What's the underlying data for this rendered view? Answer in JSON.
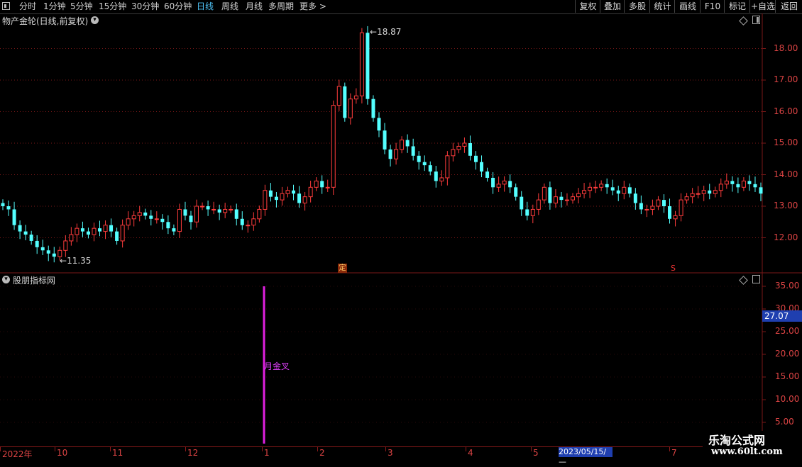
{
  "toolbar": {
    "periods": [
      {
        "label": "分时",
        "active": false
      },
      {
        "label": "1分钟",
        "active": false
      },
      {
        "label": "5分钟",
        "active": false
      },
      {
        "label": "15分钟",
        "active": false
      },
      {
        "label": "30分钟",
        "active": false
      },
      {
        "label": "60分钟",
        "active": false
      },
      {
        "label": "日线",
        "active": true
      },
      {
        "label": "周线",
        "active": false
      },
      {
        "label": "月线",
        "active": false
      },
      {
        "label": "多周期",
        "active": false
      },
      {
        "label": "更多 >",
        "active": false
      }
    ],
    "buttons": [
      "复权",
      "叠加",
      "多股",
      "统计",
      "画线",
      "F10",
      "标记",
      "+自选",
      "返回"
    ]
  },
  "main_chart": {
    "title": "物产金轮(日线,前复权)",
    "price_labels": [
      "18.00",
      "17.00",
      "16.00",
      "15.00",
      "14.00",
      "13.00",
      "12.00"
    ],
    "high_label": "18.87",
    "low_label": "11.35",
    "marker_ding": "定",
    "marker_s": "S"
  },
  "sub_chart": {
    "title": "股朋指标网",
    "labels": [
      "35.00",
      "30.00",
      "25.00",
      "20.00",
      "15.00",
      "10.00",
      "5.00"
    ],
    "current_value": "27.07",
    "signal_text": "月金叉"
  },
  "date_axis": {
    "labels": [
      "2022年",
      "10",
      "11",
      "12",
      "1",
      "2",
      "3",
      "4",
      "5",
      "7"
    ],
    "cursor": "2023/05/15/—"
  },
  "watermark": {
    "logo": "乐淘公式网",
    "url": "www.60lt.com"
  },
  "colors": {
    "up": "#ff3c3c",
    "down": "#54ffff",
    "signal": "#e020e0",
    "grid": "#7a1818",
    "axis_text": "#d44444",
    "active_tab": "#4fc3f7"
  },
  "chart_data": {
    "type": "candlestick",
    "title": "物产金轮(日线,前复权)",
    "ylim": [
      11.0,
      19.0
    ],
    "high": 18.87,
    "low": 11.35,
    "x_labels": [
      "2022年",
      "10",
      "11",
      "12",
      "1",
      "2",
      "3",
      "4",
      "5",
      "7"
    ],
    "closes": [
      13.0,
      12.9,
      12.4,
      12.2,
      12.1,
      11.9,
      11.7,
      11.6,
      11.5,
      11.4,
      11.6,
      11.9,
      12.1,
      12.3,
      12.2,
      12.1,
      12.3,
      12.2,
      12.4,
      12.2,
      11.9,
      12.4,
      12.6,
      12.7,
      12.8,
      12.7,
      12.6,
      12.6,
      12.5,
      12.3,
      12.2,
      12.9,
      12.7,
      12.5,
      13.0,
      13.0,
      12.9,
      12.9,
      12.8,
      12.9,
      12.9,
      12.6,
      12.4,
      12.4,
      12.6,
      12.9,
      13.5,
      13.3,
      13.2,
      13.4,
      13.5,
      13.4,
      13.1,
      13.3,
      13.6,
      13.8,
      13.6,
      13.6,
      16.2,
      16.8,
      15.8,
      16.4,
      16.5,
      18.5,
      16.4,
      15.8,
      15.4,
      14.8,
      14.5,
      14.8,
      15.1,
      14.9,
      14.6,
      14.4,
      14.3,
      14.1,
      13.8,
      13.9,
      14.6,
      14.8,
      14.9,
      15.0,
      14.6,
      14.4,
      14.1,
      13.9,
      13.6,
      13.7,
      13.8,
      13.6,
      13.3,
      12.9,
      12.7,
      12.9,
      13.2,
      13.6,
      13.1,
      13.3,
      13.2,
      13.2,
      13.3,
      13.4,
      13.5,
      13.6,
      13.6,
      13.7,
      13.6,
      13.5,
      13.4,
      13.6,
      13.4,
      13.1,
      12.9,
      12.9,
      13.0,
      13.2,
      13.0,
      12.6,
      12.7,
      13.2,
      13.3,
      13.4,
      13.4,
      13.5,
      13.4,
      13.5,
      13.7,
      13.8,
      13.7,
      13.6,
      13.8,
      13.7,
      13.6,
      13.4
    ],
    "indicator": {
      "name": "股朋指标网",
      "ylim": [
        5.0,
        35.0
      ],
      "current_value": 27.07,
      "signal": {
        "label": "月金叉",
        "value": 35.0,
        "x_label": "1"
      }
    }
  }
}
